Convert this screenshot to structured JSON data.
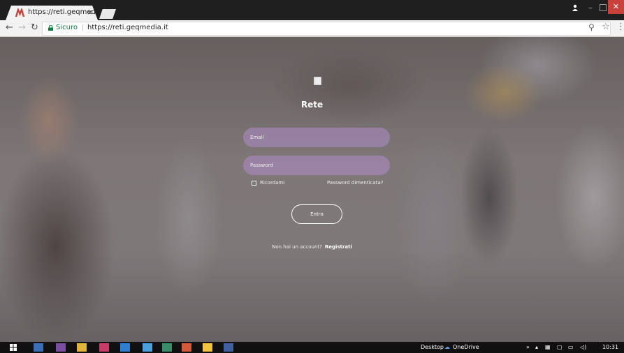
{
  "browser": {
    "tab_title": "https://reti.geqmedia.it",
    "tab_close": "×",
    "secure_label": "Sicuro",
    "separator": "|",
    "url": "https://reti.geqmedia.it",
    "window_close": "✕",
    "window_min": "–"
  },
  "page": {
    "brand_title": "Rete",
    "email_placeholder": "Email",
    "password_placeholder": "Password",
    "remember_label": "Ricordami",
    "forgot_link": "Password dimenticata?",
    "login_button": "Entra",
    "signup_prompt": "Non hai un account?",
    "signup_link": "Registrati"
  },
  "taskbar": {
    "desktop_label": "Desktop",
    "onedrive_label": "OneDrive",
    "overflow": "»",
    "clock": "10:31"
  },
  "icons": {
    "favicon": "m-logo-icon",
    "back": "back-arrow-icon",
    "forward": "forward-arrow-icon",
    "reload": "reload-icon",
    "lock": "lock-icon",
    "zoom": "zoom-icon",
    "star": "star-icon",
    "menu": "kebab-menu-icon"
  },
  "colors": {
    "accent_red": "#c8413b",
    "field_purple": "#af8cc8",
    "secure_green": "#0b8043"
  }
}
